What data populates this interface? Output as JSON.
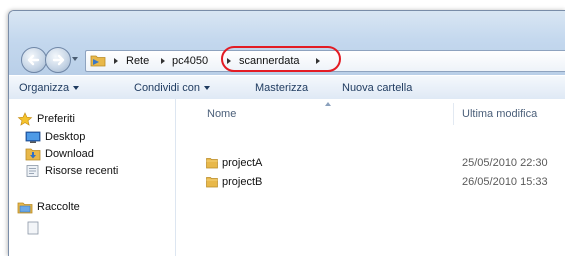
{
  "address_bar": {
    "crumbs": [
      "Rete",
      "pc4050",
      "scannerdata"
    ]
  },
  "toolbar": {
    "organize": "Organizza",
    "share": "Condividi con",
    "burn": "Masterizza",
    "new_folder": "Nuova cartella"
  },
  "nav_pane": {
    "favorites": "Preferiti",
    "desktop": "Desktop",
    "download": "Download",
    "recent": "Risorse recenti",
    "libraries": "Raccolte"
  },
  "file_list": {
    "columns": {
      "name": "Nome",
      "modified": "Ultima modifica"
    },
    "rows": [
      {
        "name": "projectA",
        "modified": "25/05/2010 22:30"
      },
      {
        "name": "projectB",
        "modified": "26/05/2010 15:33"
      }
    ]
  },
  "colors": {
    "highlight": "#e31c24",
    "folder": "#e8b84a"
  }
}
